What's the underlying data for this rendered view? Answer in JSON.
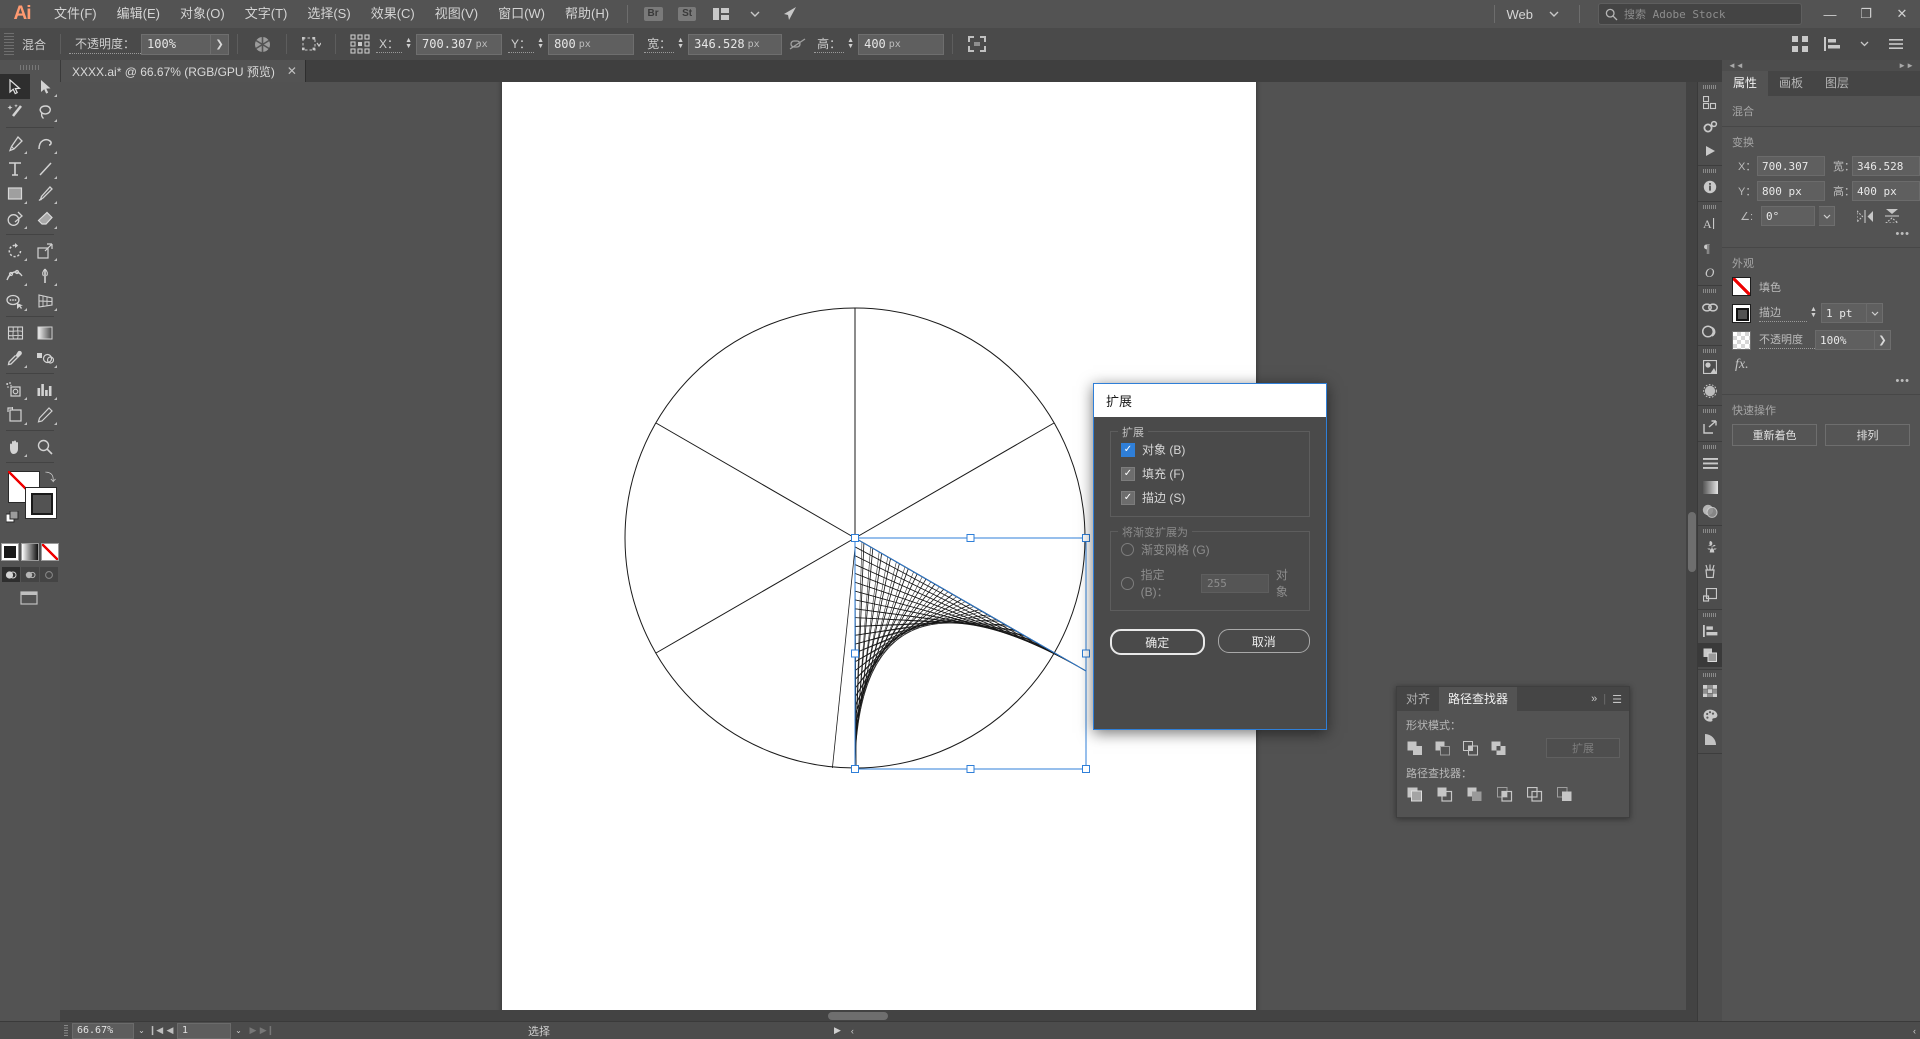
{
  "app": {
    "name": "Adobe Illustrator",
    "logo_text": "Ai"
  },
  "menubar": {
    "items": [
      {
        "label": "文件(F)",
        "name": "menu-file"
      },
      {
        "label": "编辑(E)",
        "name": "menu-edit"
      },
      {
        "label": "对象(O)",
        "name": "menu-object"
      },
      {
        "label": "文字(T)",
        "name": "menu-type"
      },
      {
        "label": "选择(S)",
        "name": "menu-select"
      },
      {
        "label": "效果(C)",
        "name": "menu-effect"
      },
      {
        "label": "视图(V)",
        "name": "menu-view"
      },
      {
        "label": "窗口(W)",
        "name": "menu-window"
      },
      {
        "label": "帮助(H)",
        "name": "menu-help"
      }
    ],
    "bridge_badge": "Br",
    "stock_badge": "St",
    "workspace": "Web",
    "search_placeholder": "搜索 Adobe Stock",
    "window_minimize": "—",
    "window_restore": "❐",
    "window_close": "✕"
  },
  "controlbar": {
    "object_label": "混合",
    "opacity_label": "不透明度：",
    "opacity_value": "100%",
    "opacity_arrow": "❯",
    "x_label": "X：",
    "x_value": "700.307",
    "x_unit": "px",
    "y_label": "Y：",
    "y_value": "800",
    "y_unit": "px",
    "w_label": "宽：",
    "w_value": "346.528",
    "w_unit": "px",
    "h_label": "高：",
    "h_value": "400",
    "h_unit": "px"
  },
  "tabbar": {
    "document_title": "XXXX.ai* @ 66.67% (RGB/GPU 预览)",
    "close_glyph": "✕"
  },
  "toolbar": {
    "tools": [
      {
        "name": "selection-tool",
        "active": true
      },
      {
        "name": "direct-selection-tool",
        "active": false
      },
      {
        "name": "magic-wand-tool",
        "active": false
      },
      {
        "name": "lasso-tool",
        "active": false
      },
      {
        "name": "pen-tool",
        "active": false
      },
      {
        "name": "curvature-tool",
        "active": false
      },
      {
        "name": "type-tool",
        "active": false
      },
      {
        "name": "line-segment-tool",
        "active": false
      },
      {
        "name": "rectangle-tool",
        "active": false
      },
      {
        "name": "paintbrush-tool",
        "active": false
      },
      {
        "name": "shaper-tool",
        "active": false
      },
      {
        "name": "eraser-tool",
        "active": false
      },
      {
        "name": "rotate-tool",
        "active": false
      },
      {
        "name": "scale-tool",
        "active": false
      },
      {
        "name": "width-tool",
        "active": false
      },
      {
        "name": "free-transform-tool",
        "active": false
      },
      {
        "name": "shape-builder-tool",
        "active": false
      },
      {
        "name": "perspective-grid-tool",
        "active": false
      },
      {
        "name": "mesh-tool",
        "active": false
      },
      {
        "name": "gradient-tool",
        "active": false
      },
      {
        "name": "eyedropper-tool",
        "active": false
      },
      {
        "name": "blend-tool",
        "active": false
      },
      {
        "name": "symbol-sprayer-tool",
        "active": false
      },
      {
        "name": "column-graph-tool",
        "active": false
      },
      {
        "name": "artboard-tool",
        "active": false
      },
      {
        "name": "slice-tool",
        "active": false
      },
      {
        "name": "hand-tool",
        "active": false
      },
      {
        "name": "zoom-tool",
        "active": false
      }
    ],
    "fill_color": "#ffffff",
    "stroke_color": "#000000",
    "color_modes": [
      "color-mode",
      "gradient-mode",
      "none-mode"
    ],
    "draw_modes": [
      "draw-normal",
      "draw-behind",
      "draw-inside"
    ]
  },
  "rightpanel": {
    "collapse_left": "◄◄",
    "collapse_right": "►►",
    "tabs": [
      {
        "label": "属性",
        "name": "tab-properties",
        "selected": true
      },
      {
        "label": "画板",
        "name": "tab-artboards",
        "selected": false
      },
      {
        "label": "图层",
        "name": "tab-layers",
        "selected": false
      }
    ],
    "selection_type": "混合",
    "transform": {
      "title": "变换",
      "x_label": "X：",
      "x_value": "700.307",
      "y_label": "Y：",
      "y_value": "800 px",
      "w_label": "宽：",
      "w_value": "346.528",
      "h_label": "高：",
      "h_value": "400 px",
      "angle_label": "∠:",
      "angle_value": "0°",
      "more_dots": "•••"
    },
    "appearance": {
      "title": "外观",
      "fill_label": "填色",
      "stroke_label": "描边",
      "stroke_weight": "1 pt",
      "opacity_label": "不透明度",
      "opacity_value": "100%",
      "fx_label": "fx.",
      "more_dots": "•••"
    },
    "quick_actions": {
      "title": "快速操作",
      "recolor": "重新着色",
      "arrange": "排列"
    }
  },
  "rail": {
    "icons": [
      {
        "name": "artboards-icon"
      },
      {
        "name": "asset-export-icon"
      },
      {
        "name": "actions-icon"
      },
      {
        "name": "document-info-icon"
      },
      {
        "name": "character-icon"
      },
      {
        "name": "paragraph-icon"
      },
      {
        "name": "glyphs-icon"
      },
      {
        "name": "links-icon"
      },
      {
        "name": "libraries-icon"
      },
      {
        "name": "image-trace-icon"
      },
      {
        "name": "transparency-icon"
      },
      {
        "name": "separations-preview-icon"
      },
      {
        "name": "align-list-icon"
      },
      {
        "name": "gradient-icon"
      },
      {
        "name": "transparency-blend-icon"
      },
      {
        "name": "symbols-icon"
      },
      {
        "name": "brushes-icon"
      },
      {
        "name": "layers-panel-icon"
      },
      {
        "name": "align-panel-icon"
      },
      {
        "name": "pathfinder-panel-icon",
        "selected": true
      },
      {
        "name": "swatches-icon"
      },
      {
        "name": "color-icon"
      },
      {
        "name": "color-guide-icon"
      }
    ]
  },
  "pathfinder": {
    "tabs": [
      {
        "label": "对齐",
        "name": "tab-align",
        "selected": false
      },
      {
        "label": "路径查找器",
        "name": "tab-pathfinder",
        "selected": true
      }
    ],
    "overflow_glyph": "»",
    "menu_glyph": "☰",
    "shape_modes_label": "形状模式：",
    "shape_modes": [
      "unite",
      "minus-front",
      "intersect",
      "exclude"
    ],
    "expand_label": "扩展",
    "pathfinders_label": "路径查找器：",
    "pathfinders": [
      "divide",
      "trim",
      "merge",
      "crop",
      "outline",
      "minus-back"
    ]
  },
  "dialog": {
    "title": "扩展",
    "expand_group": {
      "label": "扩展",
      "options": [
        {
          "label": "对象 (B)",
          "checked": true,
          "highlight": true,
          "name": "checkbox-object"
        },
        {
          "label": "填充 (F)",
          "checked": true,
          "highlight": false,
          "name": "checkbox-fill"
        },
        {
          "label": "描边 (S)",
          "checked": true,
          "highlight": false,
          "name": "checkbox-stroke"
        }
      ]
    },
    "gradient_group": {
      "label": "将渐变扩展为",
      "option_mesh": "渐变网格 (G)",
      "option_specify": "指定 (B)：",
      "specify_value": "255",
      "specify_suffix": "对象"
    },
    "ok_button": "确定",
    "cancel_button": "取消",
    "check_glyph": "✓"
  },
  "statusbar": {
    "zoom_value": "66.67%",
    "page_value": "1",
    "status_text": "选择",
    "dropdown_glyph": "⌄",
    "first_glyph": "❙◀",
    "prev_glyph": "◀",
    "next_glyph": "▶",
    "last_glyph": "▶❙",
    "play_glyph": "▶",
    "tail_glyph": "‹"
  },
  "canvas": {
    "artboard_background": "#ffffff",
    "selection_color": "#2f7fd8",
    "artwork_name": "blend-object-in-circle"
  }
}
